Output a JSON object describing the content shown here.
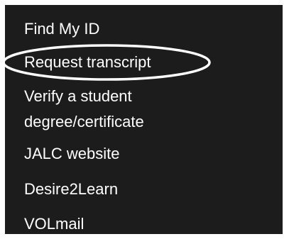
{
  "menu": {
    "items": [
      {
        "label": "Find My ID"
      },
      {
        "label": "Request transcript"
      },
      {
        "label_line1": "Verify a student",
        "label_line2": "degree/certificate"
      },
      {
        "label": "JALC website"
      },
      {
        "label": "Desire2Learn"
      },
      {
        "label": "VOLmail"
      }
    ]
  },
  "colors": {
    "panel_background": "#1c1c1c",
    "text": "#ffffff",
    "highlight_ring": "#ffffff"
  }
}
